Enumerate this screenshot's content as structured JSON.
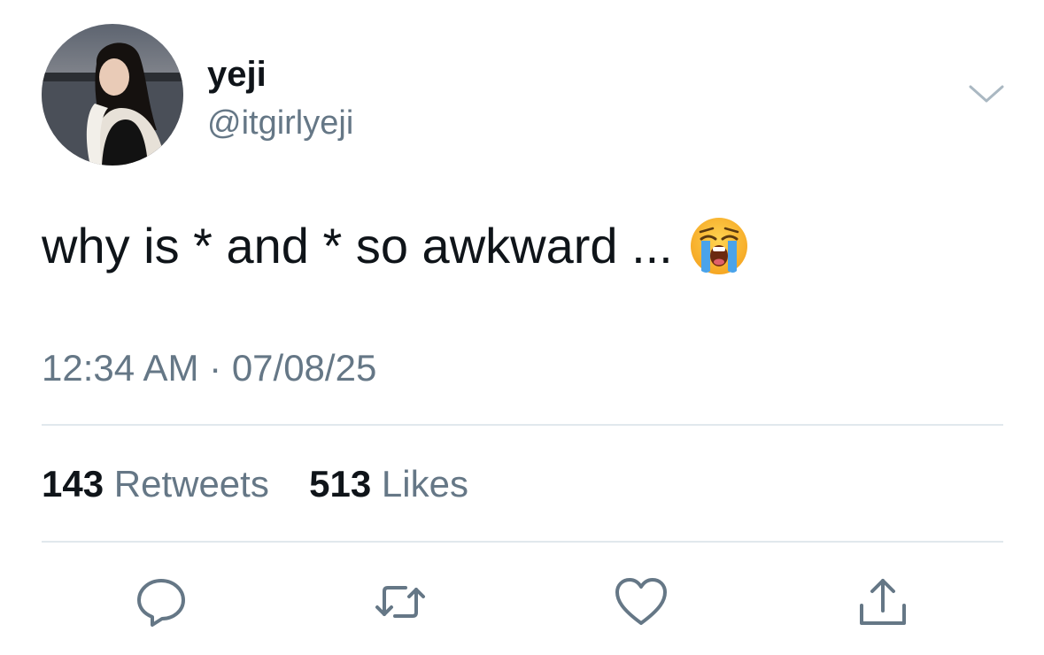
{
  "user": {
    "display_name": "yeji",
    "handle": "@itgirlyeji",
    "avatar_icon": "profile-photo"
  },
  "tweet": {
    "text": "why is * and * so awkward ...",
    "emoji": "loudly-crying-face-emoji",
    "time": "12:34 AM",
    "separator": "·",
    "date": "07/08/25"
  },
  "stats": {
    "retweets_count": "143",
    "retweets_label": "Retweets",
    "likes_count": "513",
    "likes_label": "Likes"
  },
  "actions": {
    "reply_icon": "reply-icon",
    "retweet_icon": "retweet-icon",
    "like_icon": "heart-icon",
    "share_icon": "share-icon"
  },
  "colors": {
    "text_primary": "#0f1419",
    "text_secondary": "#657786",
    "divider": "#e1e8ed",
    "icon": "#657786"
  }
}
